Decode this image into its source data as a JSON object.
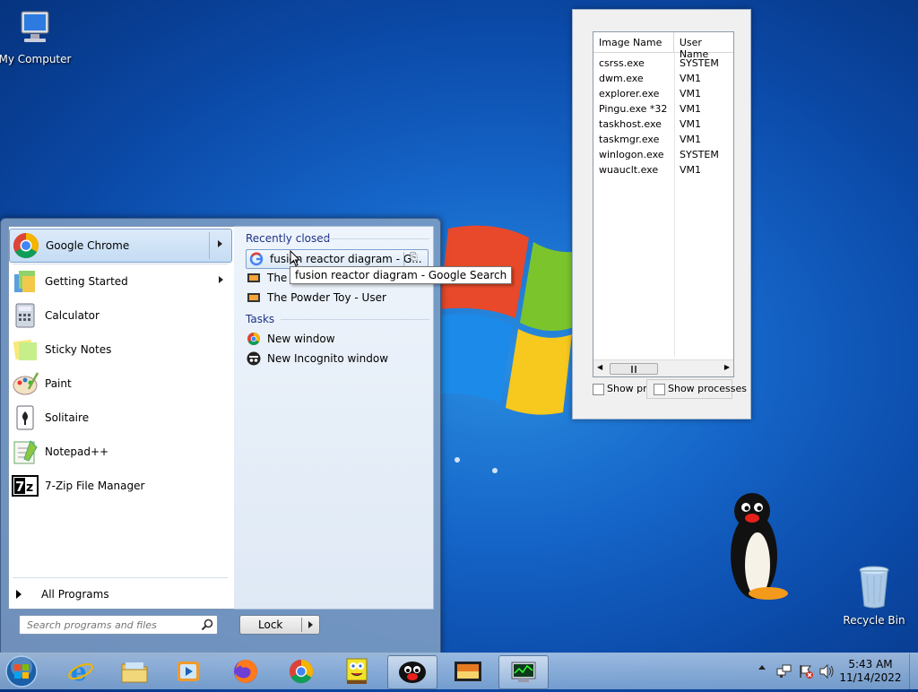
{
  "desktop": {
    "my_computer_label": "My Computer",
    "recycle_bin_label": "Recycle Bin"
  },
  "task_manager": {
    "columns": [
      "Image Name",
      "User Name"
    ],
    "rows": [
      {
        "image": "csrss.exe",
        "user": "SYSTEM"
      },
      {
        "image": "dwm.exe",
        "user": "VM1"
      },
      {
        "image": "explorer.exe",
        "user": "VM1"
      },
      {
        "image": "Pingu.exe *32",
        "user": "VM1"
      },
      {
        "image": "taskhost.exe",
        "user": "VM1"
      },
      {
        "image": "taskmgr.exe",
        "user": "VM1"
      },
      {
        "image": "winlogon.exe",
        "user": "SYSTEM"
      },
      {
        "image": "wuauclt.exe",
        "user": "VM1"
      }
    ],
    "show_processes_cut": "Show pro",
    "show_processes": "Show processes"
  },
  "start_menu": {
    "pinned": "Google Chrome",
    "programs": [
      "Getting Started",
      "Calculator",
      "Sticky Notes",
      "Paint",
      "Solitaire",
      "Notepad++",
      "7-Zip File Manager"
    ],
    "all_programs": "All Programs",
    "search_placeholder": "Search programs and files",
    "lock_label": "Lock",
    "recently_closed_heading": "Recently closed",
    "recently_closed": [
      "fusion reactor diagram - G...",
      "The",
      "The Powder Toy - User"
    ],
    "tasks_heading": "Tasks",
    "tasks": [
      "New window",
      "New Incognito window"
    ],
    "tooltip": "fusion reactor diagram - Google Search"
  },
  "taskbar": {
    "time": "5:43 AM",
    "date": "11/14/2022"
  }
}
